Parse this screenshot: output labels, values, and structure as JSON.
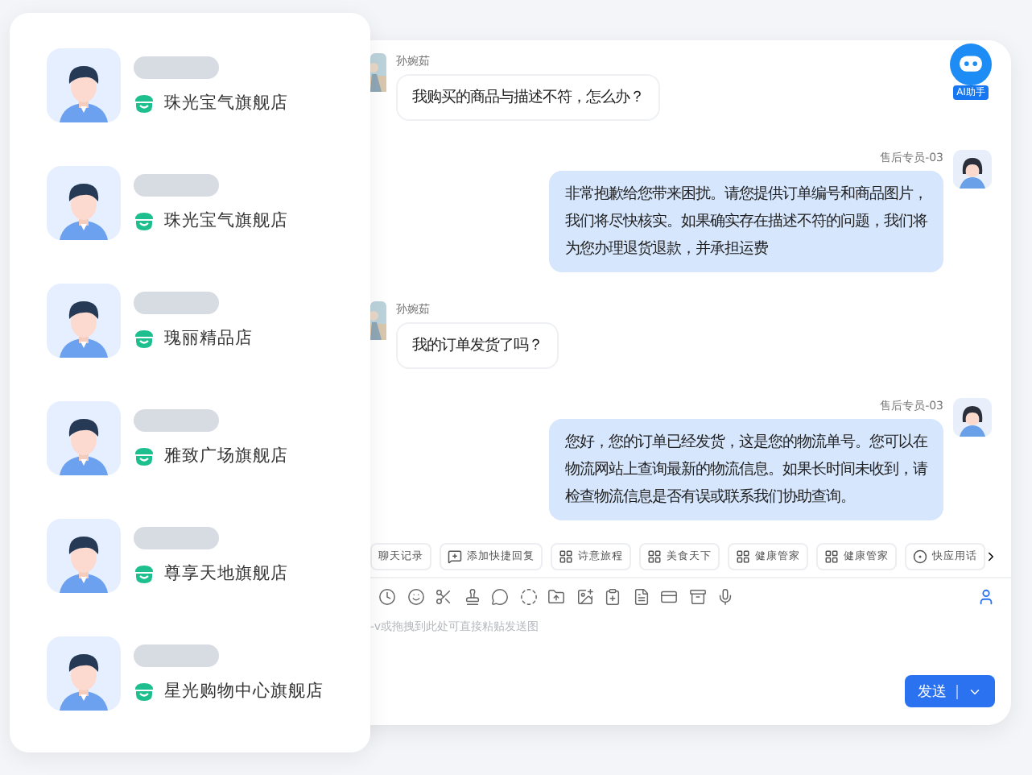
{
  "stores": [
    {
      "name": "珠光宝气旗舰店"
    },
    {
      "name": "珠光宝气旗舰店"
    },
    {
      "name": "瑰丽精品店"
    },
    {
      "name": "雅致广场旗舰店"
    },
    {
      "name": "尊享天地旗舰店"
    },
    {
      "name": "星光购物中心旗舰店"
    }
  ],
  "chat": {
    "ai_badge": "AI助手",
    "messages": [
      {
        "kind": "incoming",
        "sender": "孙婉茹",
        "text": "我购买的商品与描述不符，怎么办？"
      },
      {
        "kind": "outgoing",
        "sender": "售后专员-03",
        "text": "非常抱歉给您带来困扰。请您提供订单编号和商品图片，我们将尽快核实。如果确实存在描述不符的问题，我们将为您办理退货退款，并承担运费"
      },
      {
        "kind": "incoming",
        "sender": "孙婉茹",
        "text": "我的订单发货了吗？"
      },
      {
        "kind": "outgoing",
        "sender": "售后专员-03",
        "text": "您好，您的订单已经发货，这是您的物流单号。您可以在物流网站上查询最新的物流信息。如果长时间未收到，请检查物流信息是否有误或联系我们协助查询。"
      }
    ],
    "quick_replies": [
      {
        "label": "聊天记录",
        "kind": "plain"
      },
      {
        "label": "添加快捷回复",
        "kind": "add"
      },
      {
        "label": "诗意旅程",
        "kind": "grid"
      },
      {
        "label": "美食天下",
        "kind": "grid"
      },
      {
        "label": "健康管家",
        "kind": "grid"
      },
      {
        "label": "健康管家",
        "kind": "grid"
      },
      {
        "label": "快应用话",
        "kind": "circle"
      }
    ],
    "input": {
      "placeholder": "-v或拖拽到此处可直接粘贴发送图"
    },
    "send_button": "发送"
  }
}
